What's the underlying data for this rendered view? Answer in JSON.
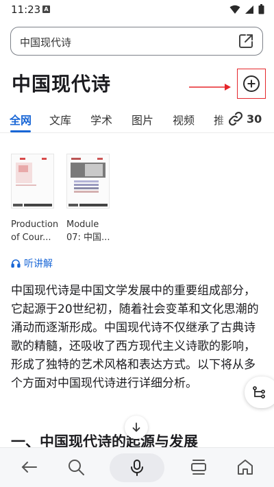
{
  "status_bar": {
    "time": "11:23",
    "notification_badge": "A"
  },
  "search": {
    "query": "中国现代诗"
  },
  "header": {
    "title": "中国现代诗"
  },
  "tabs": [
    {
      "label": "全网",
      "active": true
    },
    {
      "label": "文库"
    },
    {
      "label": "学术"
    },
    {
      "label": "图片"
    },
    {
      "label": "视频"
    }
  ],
  "tabs_overflow": {
    "partial_label": "推",
    "link_count": "30"
  },
  "documents": [
    {
      "title": "Production of Cour..."
    },
    {
      "title": "Module 07: 中国..."
    }
  ],
  "listen": {
    "label": "听讲解"
  },
  "article": {
    "paragraph": "中国现代诗是中国文学发展中的重要组成部分，它起源于20世纪初，随着社会变革和文化思潮的涌动而逐渐形成。中国现代诗不仅继承了古典诗歌的精髓，还吸收了西方现代主义诗歌的影响，形成了独特的艺术风格和表达方式。以下将从多个方面对中国现代诗进行详细分析。",
    "section_heading": "一、中国现代诗的起源与发展"
  },
  "colors": {
    "accent": "#1866d6",
    "highlight": "#e5252a"
  },
  "bottom_nav": [
    "back-icon",
    "search-icon",
    "mic-icon",
    "tabs-icon",
    "home-icon"
  ]
}
